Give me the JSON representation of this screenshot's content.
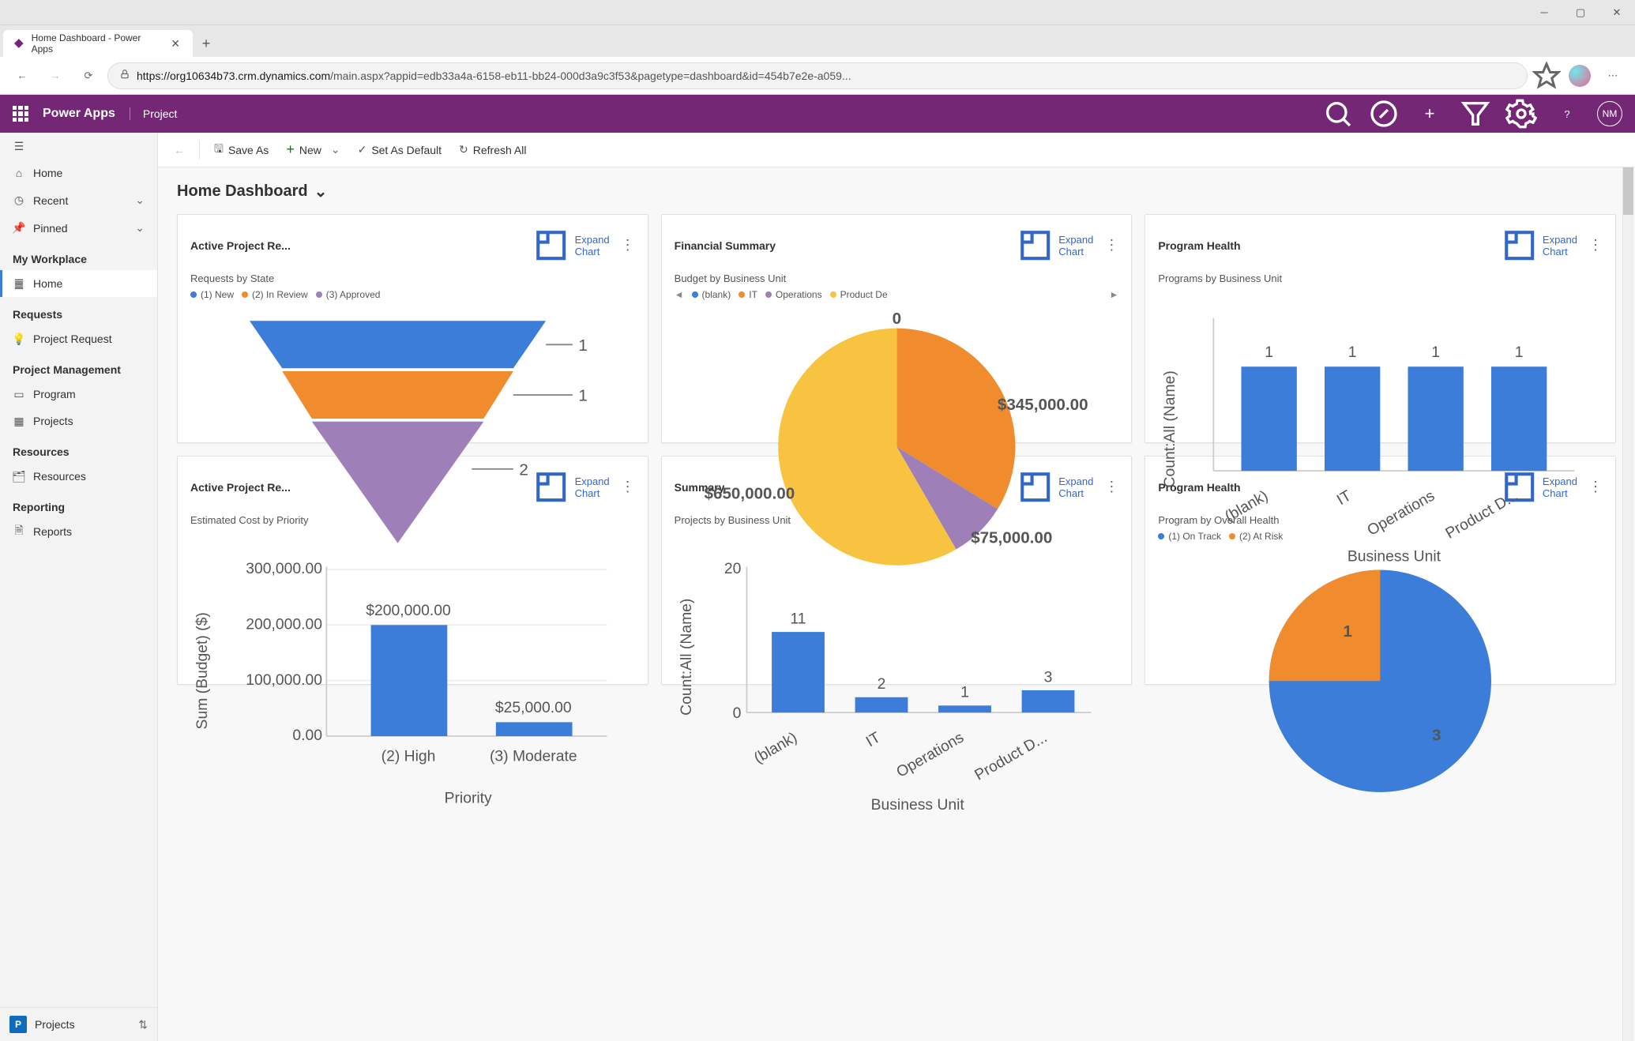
{
  "browser": {
    "tab_title": "Home Dashboard - Power Apps",
    "url_host": "https://org10634b73.crm.dynamics.com",
    "url_path": "/main.aspx?appid=edb33a4a-6158-eb11-bb24-000d3a9c3f53&pagetype=dashboard&id=454b7e2e-a059..."
  },
  "header": {
    "app_name": "Power Apps",
    "app_context": "Project",
    "avatar_initials": "NM"
  },
  "cmdbar": {
    "save_as": "Save As",
    "new": "New",
    "set_default": "Set As Default",
    "refresh": "Refresh All"
  },
  "page": {
    "title": "Home Dashboard"
  },
  "sidebar": {
    "home": "Home",
    "recent": "Recent",
    "pinned": "Pinned",
    "section_workplace": "My Workplace",
    "item_home2": "Home",
    "section_requests": "Requests",
    "item_project_request": "Project Request",
    "section_pm": "Project Management",
    "item_program": "Program",
    "item_projects": "Projects",
    "section_resources": "Resources",
    "item_resources": "Resources",
    "section_reporting": "Reporting",
    "item_reports": "Reports",
    "footer_badge": "P",
    "footer_label": "Projects"
  },
  "cards": {
    "c1": {
      "title": "Active Project Re...",
      "expand": "Expand Chart",
      "subtitle": "Requests by State"
    },
    "c2": {
      "title": "Financial Summary",
      "expand": "Expand Chart",
      "subtitle": "Budget by Business Unit"
    },
    "c3": {
      "title": "Program Health",
      "expand": "Expand Chart",
      "subtitle": "Programs by Business Unit"
    },
    "c4": {
      "title": "Active Project Re...",
      "expand": "Expand Chart",
      "subtitle": "Estimated Cost by Priority"
    },
    "c5": {
      "title": "Summary",
      "expand": "Expand Chart",
      "subtitle": "Projects by Business Unit"
    },
    "c6": {
      "title": "Program Health",
      "expand": "Expand Chart",
      "subtitle": "Program by Overall Health"
    }
  },
  "legends": {
    "funnel": [
      "(1) New",
      "(2) In Review",
      "(3) Approved"
    ],
    "pie_budget": [
      "(blank)",
      "IT",
      "Operations",
      "Product De"
    ],
    "health": [
      "(1) On Track",
      "(2) At Risk"
    ]
  },
  "chart_data": [
    {
      "type": "funnel",
      "title": "Requests by State",
      "categories": [
        "(1) New",
        "(2) In Review",
        "(3) Approved"
      ],
      "values": [
        1,
        1,
        2
      ],
      "colors": [
        "#3B7DD8",
        "#F08C2E",
        "#9E7FB8"
      ]
    },
    {
      "type": "pie",
      "title": "Budget by Business Unit",
      "labels": [
        "(blank)",
        "IT",
        "Operations",
        "Product De"
      ],
      "display_values": [
        "0",
        "$345,000.00",
        "$75,000.00",
        "$650,000.00"
      ],
      "values": [
        0,
        345000,
        75000,
        650000
      ],
      "colors": [
        "#3B7DD8",
        "#F08C2E",
        "#9E7FB8",
        "#F7C340"
      ]
    },
    {
      "type": "bar",
      "title": "Programs by Business Unit",
      "categories": [
        "(blank)",
        "IT",
        "Operations",
        "Product D..."
      ],
      "values": [
        1,
        1,
        1,
        1
      ],
      "xlabel": "Business Unit",
      "ylabel": "Count:All (Name)",
      "color": "#3B7DD8"
    },
    {
      "type": "bar",
      "title": "Estimated Cost by Priority",
      "categories": [
        "(2) High",
        "(3) Moderate"
      ],
      "values": [
        200000,
        25000
      ],
      "display_values": [
        "$200,000.00",
        "$25,000.00"
      ],
      "xlabel": "Priority",
      "ylabel": "Sum (Budget) ($)",
      "ylim": [
        0,
        300000
      ],
      "yticks": [
        "0.00",
        "100,000.00",
        "200,000.00",
        "300,000.00"
      ],
      "color": "#3B7DD8"
    },
    {
      "type": "bar",
      "title": "Projects by Business Unit",
      "categories": [
        "(blank)",
        "IT",
        "Operations",
        "Product D..."
      ],
      "values": [
        11,
        2,
        1,
        3
      ],
      "xlabel": "Business Unit",
      "ylabel": "Count:All (Name)",
      "ylim": [
        0,
        20
      ],
      "color": "#3B7DD8"
    },
    {
      "type": "pie",
      "title": "Program by Overall Health",
      "labels": [
        "(1) On Track",
        "(2) At Risk"
      ],
      "values": [
        3,
        1
      ],
      "colors": [
        "#3B7DD8",
        "#F08C2E"
      ]
    }
  ]
}
